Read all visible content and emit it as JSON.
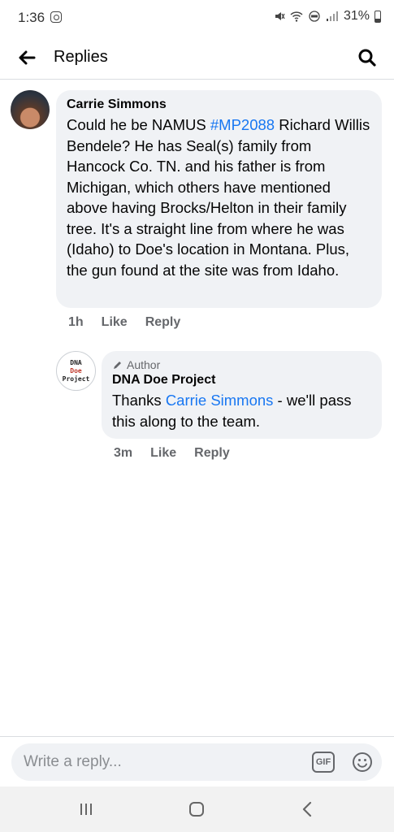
{
  "status_bar": {
    "time": "1:36",
    "battery": "31%"
  },
  "header": {
    "title": "Replies",
    "back_icon": "arrow-left-icon",
    "search_icon": "search-icon"
  },
  "comments": [
    {
      "author": "Carrie Simmons",
      "text_before_tag": "Could he be NAMUS ",
      "hashtag": "#MP2088",
      "text_after_tag": " Richard Willis Bendele? He has Seal(s) family from Hancock Co. TN.  and his father is from Michigan, which others have mentioned above having Brocks/Helton in their family tree. It's a straight line from where he was (Idaho) to Doe's location in Montana. Plus, the gun found at the site was from Idaho.",
      "time": "1h",
      "like_label": "Like",
      "reply_label": "Reply"
    },
    {
      "badge": "Author",
      "author": "DNA Doe Project",
      "avatar_lines": [
        "DNA",
        "Doe",
        "Project"
      ],
      "text_before_mention": "Thanks ",
      "mention": "Carrie Simmons",
      "text_after_mention": " - we'll pass this along to the team.",
      "time": "3m",
      "like_label": "Like",
      "reply_label": "Reply"
    }
  ],
  "composer": {
    "placeholder": "Write a reply...",
    "gif_label": "GIF"
  },
  "colors": {
    "link": "#1877f2",
    "bubble": "#f0f2f5",
    "secondary_text": "#65676b"
  }
}
